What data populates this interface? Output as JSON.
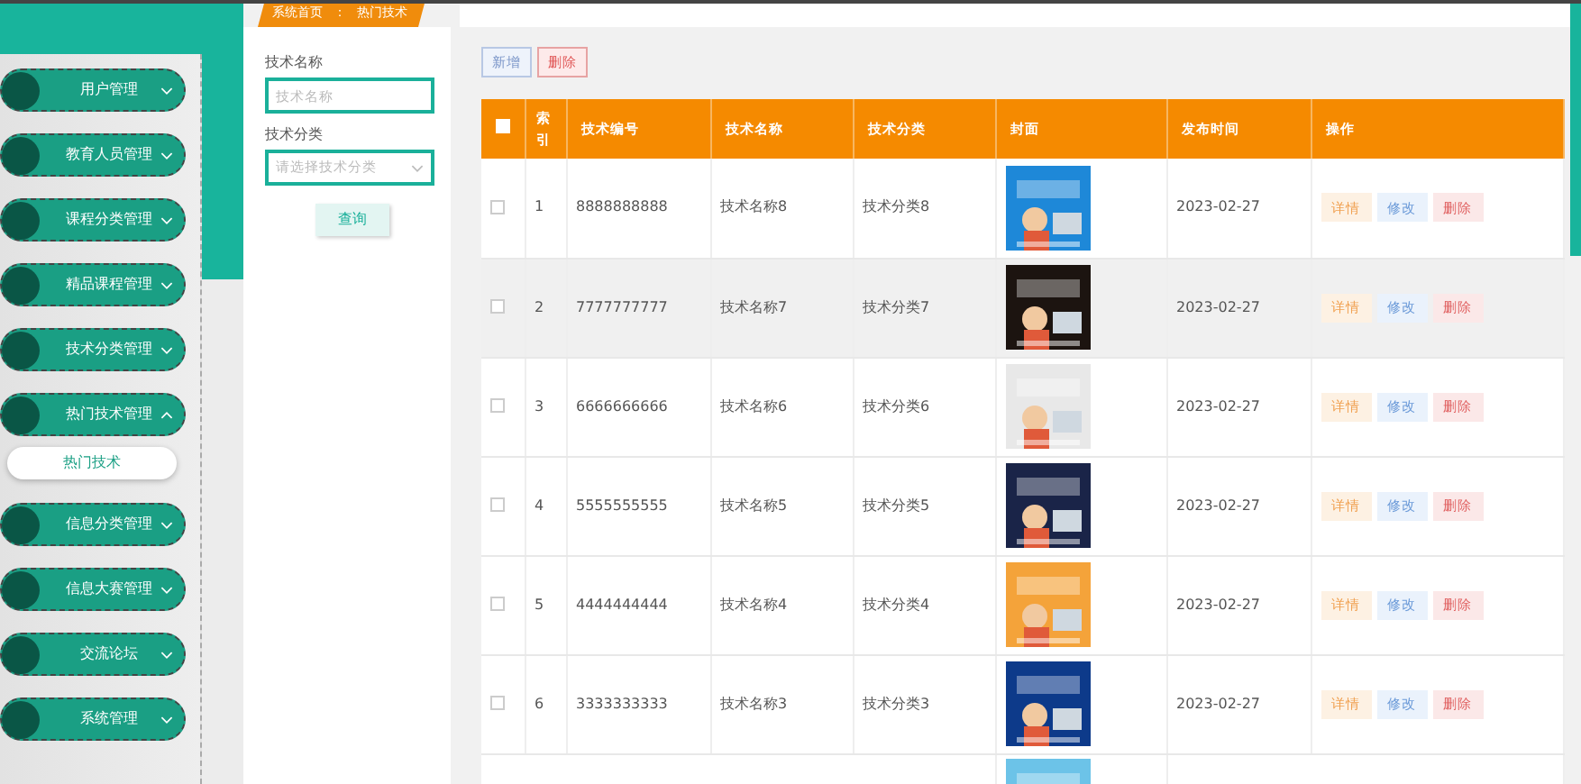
{
  "sidebar": {
    "items": [
      {
        "label": "用户管理",
        "expanded": false
      },
      {
        "label": "教育人员管理",
        "expanded": false
      },
      {
        "label": "课程分类管理",
        "expanded": false
      },
      {
        "label": "精品课程管理",
        "expanded": false
      },
      {
        "label": "技术分类管理",
        "expanded": false
      },
      {
        "label": "热门技术管理",
        "expanded": true,
        "children": [
          {
            "label": "热门技术",
            "selected": true
          }
        ]
      },
      {
        "label": "信息分类管理",
        "expanded": false
      },
      {
        "label": "信息大赛管理",
        "expanded": false
      },
      {
        "label": "交流论坛",
        "expanded": false
      },
      {
        "label": "系统管理",
        "expanded": false
      }
    ]
  },
  "breadcrumb": [
    "系统首页",
    "：",
    "热门技术"
  ],
  "search": {
    "fields": [
      {
        "kind": "text",
        "label": "技术名称",
        "placeholder": "技术名称"
      },
      {
        "kind": "select",
        "label": "技术分类",
        "placeholder": "请选择技术分类"
      }
    ],
    "button": "查询"
  },
  "toolbar": [
    {
      "kind": "add",
      "label": "新增"
    },
    {
      "kind": "delete",
      "label": "删除"
    }
  ],
  "table": {
    "select_all_checked": false,
    "columns": [
      "索引",
      "技术编号",
      "技术名称",
      "技术分类",
      "封面",
      "发布时间",
      "操作"
    ],
    "rows": [
      {
        "hovered": false,
        "checked": false,
        "index": "1",
        "code": "8888888888",
        "name": "技术名称8",
        "category": "技术分类8",
        "date": "2023-02-27",
        "actions": [
          "详情",
          "修改",
          "删除"
        ]
      },
      {
        "hovered": true,
        "checked": false,
        "index": "2",
        "code": "7777777777",
        "name": "技术名称7",
        "category": "技术分类7",
        "date": "2023-02-27",
        "actions": [
          "详情",
          "修改",
          "删除"
        ]
      },
      {
        "hovered": false,
        "checked": false,
        "index": "3",
        "code": "6666666666",
        "name": "技术名称6",
        "category": "技术分类6",
        "date": "2023-02-27",
        "actions": [
          "详情",
          "修改",
          "删除"
        ]
      },
      {
        "hovered": false,
        "checked": false,
        "index": "4",
        "code": "5555555555",
        "name": "技术名称5",
        "category": "技术分类5",
        "date": "2023-02-27",
        "actions": [
          "详情",
          "修改",
          "删除"
        ]
      },
      {
        "hovered": false,
        "checked": false,
        "index": "5",
        "code": "4444444444",
        "name": "技术名称4",
        "category": "技术分类4",
        "date": "2023-02-27",
        "actions": [
          "详情",
          "修改",
          "删除"
        ]
      },
      {
        "hovered": false,
        "checked": false,
        "index": "6",
        "code": "3333333333",
        "name": "技术名称3",
        "category": "技术分类3",
        "date": "2023-02-27",
        "actions": [
          "详情",
          "修改",
          "删除"
        ]
      },
      {
        "hovered": false
      }
    ]
  }
}
